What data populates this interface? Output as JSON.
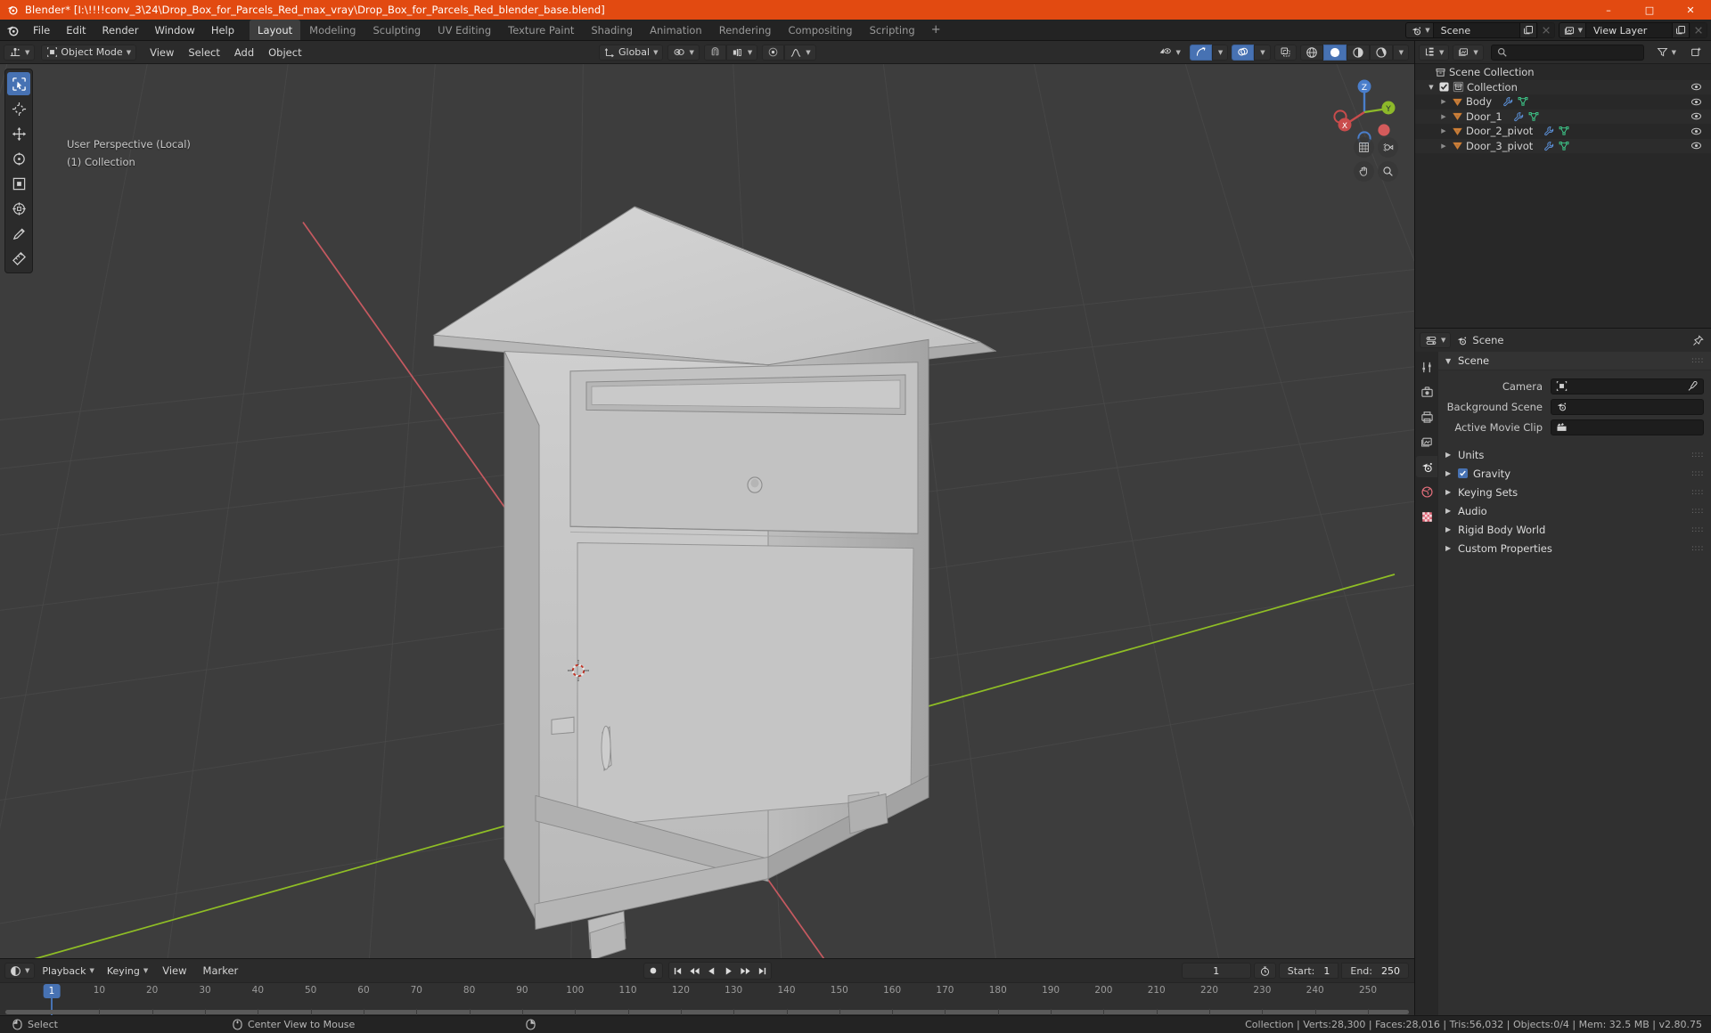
{
  "titlebar": {
    "title": "Blender* [I:\\!!!!conv_3\\24\\Drop_Box_for_Parcels_Red_max_vray\\Drop_Box_for_Parcels_Red_blender_base.blend]",
    "minimize": "–",
    "maximize": "□",
    "close": "✕"
  },
  "topbar": {
    "menus": [
      "File",
      "Edit",
      "Render",
      "Window",
      "Help"
    ],
    "tabs": [
      {
        "label": "Layout",
        "active": true
      },
      {
        "label": "Modeling",
        "active": false
      },
      {
        "label": "Sculpting",
        "active": false
      },
      {
        "label": "UV Editing",
        "active": false
      },
      {
        "label": "Texture Paint",
        "active": false
      },
      {
        "label": "Shading",
        "active": false
      },
      {
        "label": "Animation",
        "active": false
      },
      {
        "label": "Rendering",
        "active": false
      },
      {
        "label": "Compositing",
        "active": false
      },
      {
        "label": "Scripting",
        "active": false
      }
    ],
    "add_tab": "+",
    "scene_name": "Scene",
    "view_layer_name": "View Layer"
  },
  "viewport_header": {
    "mode": "Object Mode",
    "menus": [
      "View",
      "Select",
      "Add",
      "Object"
    ],
    "transform_orientation": "Global",
    "accent_blue": "#4772b3"
  },
  "viewport": {
    "perspective_label": "User Perspective (Local)",
    "collection_label": "(1) Collection",
    "background": "#3d3d3d",
    "axis_x_color": "#cd5b62",
    "axis_y_color": "#94c524",
    "gizmo": {
      "x_label": "X",
      "y_label": "Y",
      "z_label": "Z"
    },
    "tools": [
      "select-box-tool",
      "cursor-tool",
      "move-tool",
      "rotate-tool",
      "scale-tool",
      "transform-tool",
      "annotate-tool",
      "measure-tool"
    ]
  },
  "outliner": {
    "search_placeholder": "",
    "rows": [
      {
        "label": "Scene Collection",
        "indent": 0,
        "icon": "collection-icon",
        "expandable": false,
        "checkbox": false,
        "modifiers": false,
        "eye": false
      },
      {
        "label": "Collection",
        "indent": 1,
        "icon": "collection-icon",
        "expandable": true,
        "checkbox": true,
        "modifiers": false,
        "eye": true
      },
      {
        "label": "Body",
        "indent": 2,
        "icon": "mesh-icon",
        "expandable": true,
        "checkbox": false,
        "modifiers": true,
        "eye": true
      },
      {
        "label": "Door_1",
        "indent": 2,
        "icon": "mesh-icon",
        "expandable": true,
        "checkbox": false,
        "modifiers": true,
        "eye": true
      },
      {
        "label": "Door_2_pivot",
        "indent": 2,
        "icon": "mesh-icon",
        "expandable": true,
        "checkbox": false,
        "modifiers": true,
        "eye": true
      },
      {
        "label": "Door_3_pivot",
        "indent": 2,
        "icon": "mesh-icon",
        "expandable": true,
        "checkbox": false,
        "modifiers": true,
        "eye": true
      }
    ]
  },
  "properties": {
    "breadcrumb": "Scene",
    "panel_title": "Scene",
    "fields": [
      {
        "label": "Camera",
        "value": "",
        "icon": "camera-icon",
        "eyedropper": true
      },
      {
        "label": "Background Scene",
        "value": "",
        "icon": "scene-icon",
        "eyedropper": false
      },
      {
        "label": "Active Movie Clip",
        "value": "",
        "icon": "clip-icon",
        "eyedropper": false
      }
    ],
    "sections": [
      {
        "label": "Units",
        "checkbox": false
      },
      {
        "label": "Gravity",
        "checkbox": true
      },
      {
        "label": "Keying Sets",
        "checkbox": false
      },
      {
        "label": "Audio",
        "checkbox": false
      },
      {
        "label": "Rigid Body World",
        "checkbox": false
      },
      {
        "label": "Custom Properties",
        "checkbox": false
      }
    ]
  },
  "timeline": {
    "editor_menus": [
      "Playback",
      "Keying",
      "View",
      "Marker"
    ],
    "current_frame": "1",
    "start_label": "Start:",
    "start_value": "1",
    "end_label": "End:",
    "end_value": "250",
    "playhead_frame": "1",
    "ticks": [
      10,
      20,
      30,
      40,
      50,
      60,
      70,
      80,
      90,
      100,
      110,
      120,
      130,
      140,
      150,
      160,
      170,
      180,
      190,
      200,
      210,
      220,
      230,
      240,
      250
    ]
  },
  "statusbar": {
    "left_action": "Select",
    "middle_action": "Center View to Mouse",
    "stats": "Collection | Verts:28,300 | Faces:28,016 | Tris:56,032 | Objects:0/4 | Mem: 32.5 MB | v2.80.75"
  }
}
